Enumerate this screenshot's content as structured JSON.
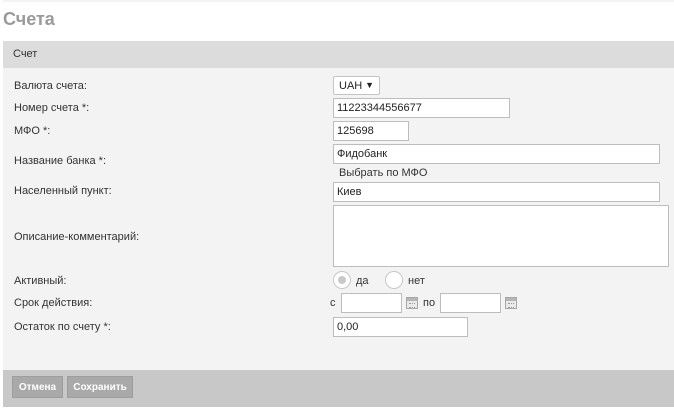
{
  "page": {
    "title": "Счета"
  },
  "panel": {
    "header": "Счет"
  },
  "form": {
    "currency": {
      "label": "Валюта счета:",
      "value": "UAH",
      "arrow": "▼"
    },
    "account_number": {
      "label": "Номер счета *:",
      "value": "11223344556677"
    },
    "mfo": {
      "label": "МФО *:",
      "value": "125698"
    },
    "bank_name": {
      "label": "Название банка *:",
      "value": "Фидобанк",
      "select_by_mfo": "Выбрать по МФО"
    },
    "city": {
      "label": "Населенный пункт:",
      "value": "Киев"
    },
    "description": {
      "label": "Описание-комментарий:",
      "value": ""
    },
    "active": {
      "label": "Активный:",
      "yes": "да",
      "no": "нет",
      "selected": "да"
    },
    "validity": {
      "label": "Срок действия:",
      "from_label": "с",
      "to_label": "по",
      "from_value": "",
      "to_value": ""
    },
    "balance": {
      "label": "Остаток по счету *:",
      "value": "0,00"
    }
  },
  "footer": {
    "cancel": "Отмена",
    "save": "Сохранить"
  },
  "colors": {
    "panel_bg": "#f3f3f3",
    "header_bg": "#dcdcdc",
    "footer_bg": "#c8c8c8",
    "button_bg": "#a9a9a9",
    "title_color": "#9a9a9a"
  }
}
